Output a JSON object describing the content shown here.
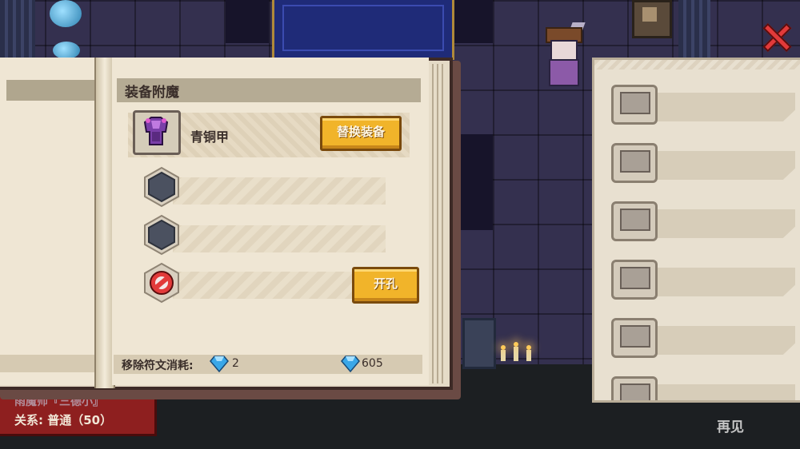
{
  "book": {
    "title": "装备附魔",
    "equipment": {
      "name": "青铜甲",
      "icon": "bronze-armor-icon"
    },
    "replace_label": "替换装备",
    "slots": [
      {
        "state": "empty",
        "icon": "empty-hex-socket-icon"
      },
      {
        "state": "empty",
        "icon": "empty-hex-socket-icon"
      },
      {
        "state": "locked",
        "icon": "no-entry-icon"
      }
    ],
    "open_hole_label": "开孔",
    "footer": {
      "remove_label": "移除符文消耗:",
      "remove_cost": "2",
      "gem_total": "605",
      "gem_icon": "blue-gem-icon"
    }
  },
  "npc": {
    "name": "雨魔师『三德小』",
    "relation": "关系: 普通（50）"
  },
  "right_panel": {
    "slot_count": 6
  },
  "exit_label": "再见",
  "colors": {
    "button_gold": "#f1b42a",
    "close_red": "#e23a3a",
    "npc_banner": "#8e1f1f"
  }
}
